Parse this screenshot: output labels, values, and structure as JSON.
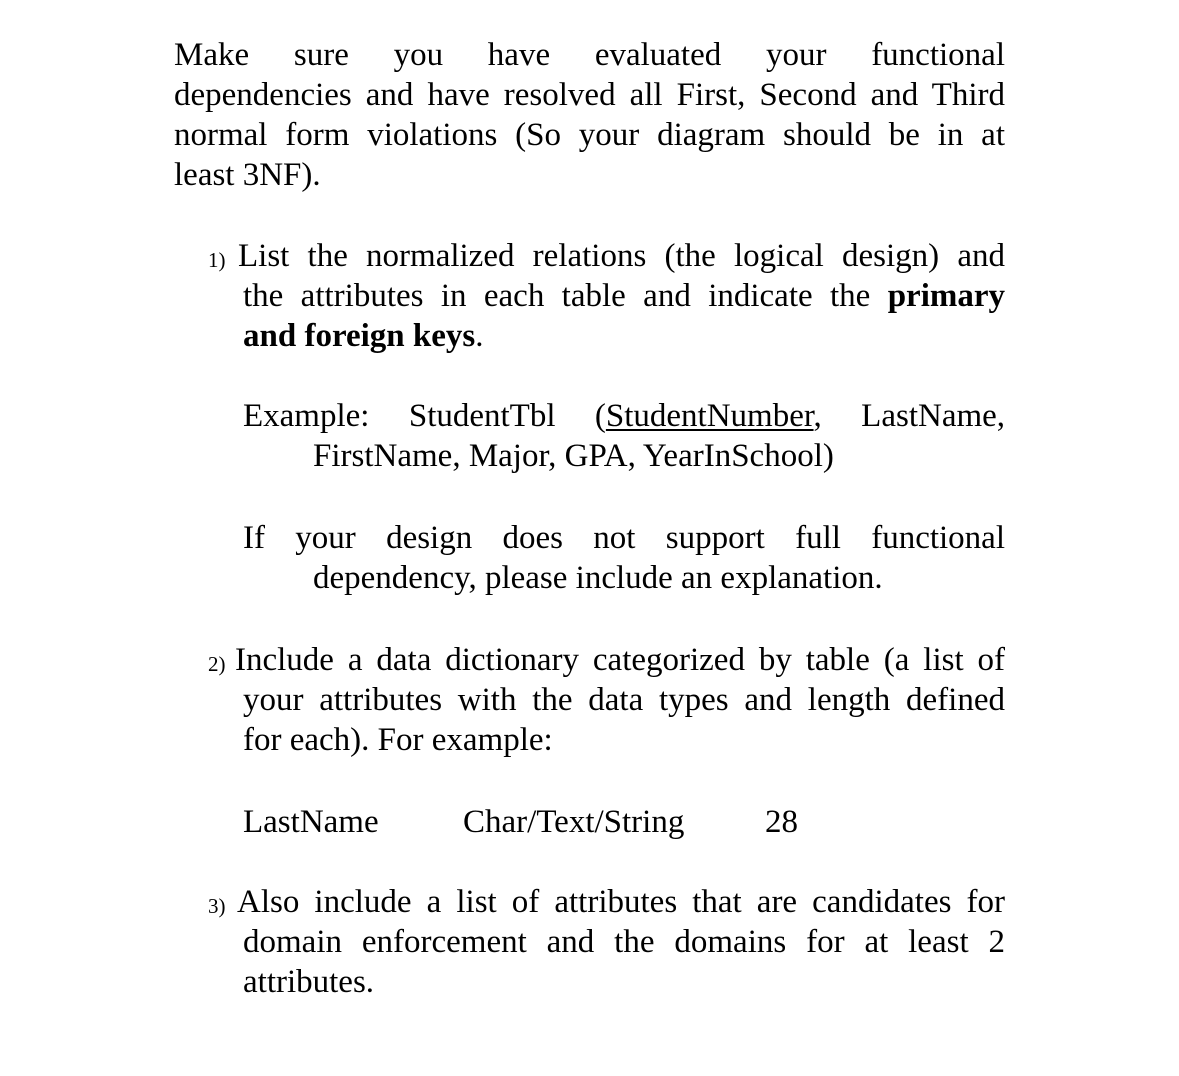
{
  "intro": {
    "lines": [
      "Make sure you have evaluated your functional",
      "dependencies and have resolved all First, Second and Third",
      "normal form violations (So your diagram should be in at",
      "least 3NF)."
    ]
  },
  "items": [
    {
      "number": "1)",
      "lines": [
        "List the normalized relations (the logical design) and",
        "the attributes in each table and indicate the "
      ],
      "bold_1": "primary",
      "bold_2": "and foreign keys",
      "bold_2_suffix": ".",
      "example": {
        "label": "Example:",
        "table": "StudentTbl",
        "open_paren": "(",
        "primary_key": "StudentNumber",
        "after_key": ",",
        "attr_1": "LastName,",
        "line_2": "FirstName, Major, GPA, YearInSchool)"
      },
      "note": {
        "line_1": "If your design does not support full functional",
        "line_2": "dependency, please include an explanation."
      }
    },
    {
      "number": "2)",
      "lines": [
        "Include a data dictionary categorized by table (a list of",
        "your attributes with the data types and length defined",
        "for each). For example:"
      ],
      "dictionary_example": {
        "attribute": "LastName",
        "type": "Char/Text/String",
        "length": "28"
      }
    },
    {
      "number": "3)",
      "lines": [
        "Also include a list of attributes that are candidates for",
        "domain enforcement and the domains for at least 2",
        "attributes."
      ]
    }
  ]
}
